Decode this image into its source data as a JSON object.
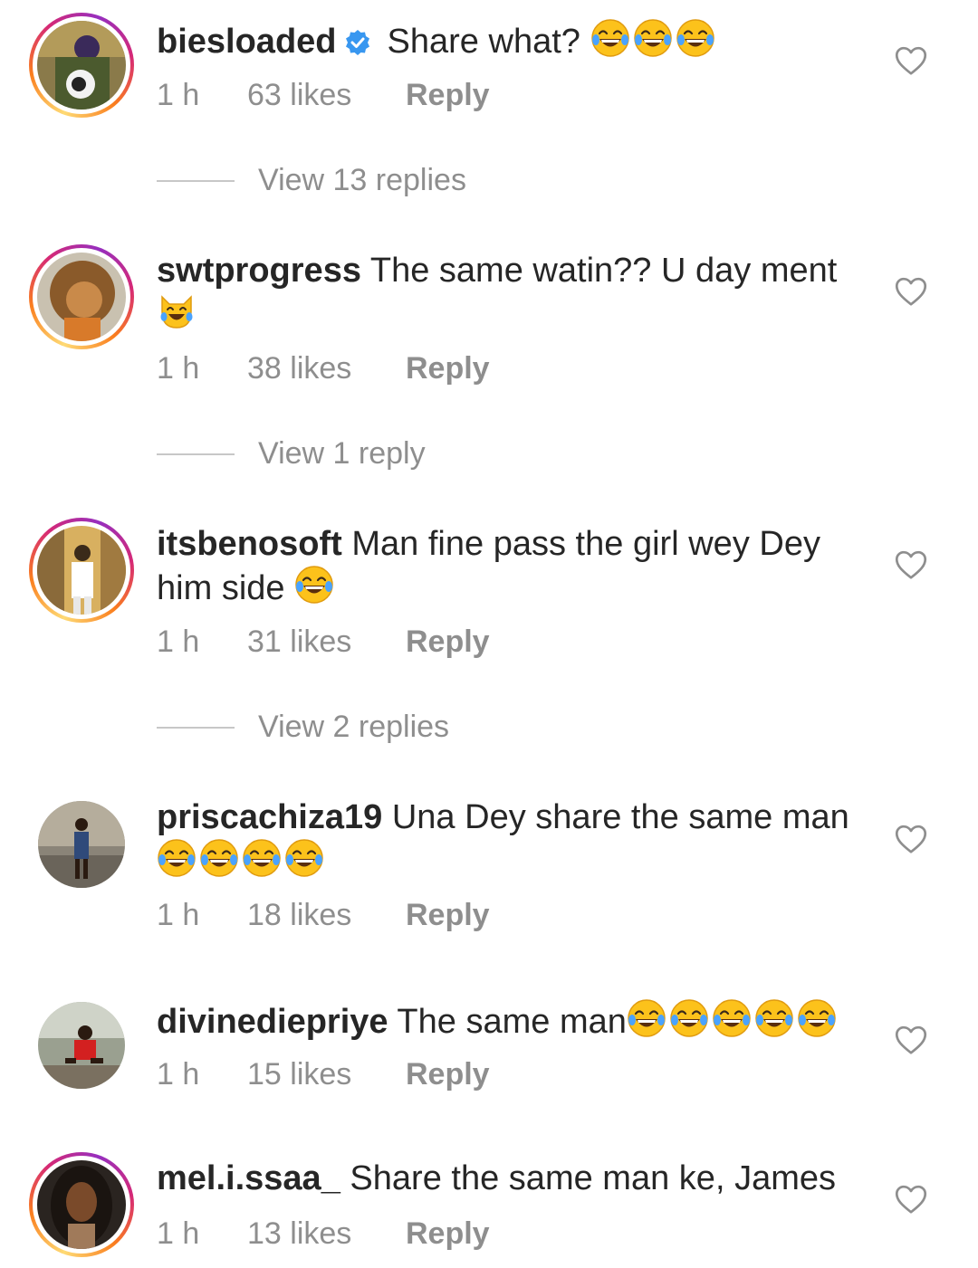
{
  "comments": [
    {
      "username": "biesloaded",
      "verified": true,
      "text": "Share what? 😂😂😂",
      "time": "1 h",
      "likes": "63 likes",
      "reply_label": "Reply",
      "view_replies": "View 13 replies",
      "ring": true
    },
    {
      "username": "swtprogress",
      "verified": false,
      "text": "The same watin?? U day ment 😹",
      "time": "1 h",
      "likes": "38 likes",
      "reply_label": "Reply",
      "view_replies": "View 1 reply",
      "ring": true
    },
    {
      "username": "itsbenosoft",
      "verified": false,
      "text": "Man fine pass the girl wey Dey him side 😂",
      "time": "1 h",
      "likes": "31 likes",
      "reply_label": "Reply",
      "view_replies": "View 2 replies",
      "ring": true
    },
    {
      "username": "priscachiza19",
      "verified": false,
      "text": "Una Dey share the same man 😂😂😂😂",
      "time": "1 h",
      "likes": "18 likes",
      "reply_label": "Reply",
      "view_replies": "",
      "ring": false
    },
    {
      "username": "divinediepriye",
      "verified": false,
      "text": "The same man😂😂😂😂😂",
      "time": "1 h",
      "likes": "15 likes",
      "reply_label": "Reply",
      "view_replies": "",
      "ring": false
    },
    {
      "username": "mel.i.ssaa_",
      "verified": false,
      "text": "Share the same man ke, James",
      "time": "1 h",
      "likes": "13 likes",
      "reply_label": "Reply",
      "view_replies": "",
      "ring": true
    }
  ],
  "colors": {
    "text": "#262626",
    "secondary": "#8e8e8e",
    "verified_blue": "#3897f0",
    "divider": "#c7c7c7"
  },
  "icons": {
    "like": "heart-outline-icon",
    "verified": "verified-badge-icon",
    "emoji_laugh": "face-with-tears-of-joy",
    "emoji_cat": "cat-with-tears-of-joy"
  }
}
